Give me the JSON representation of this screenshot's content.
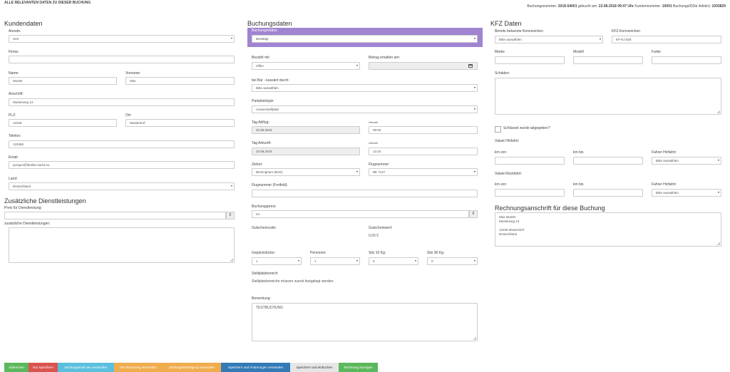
{
  "header": {
    "title": "ALLE RELEVANTEN DATEN ZU DIESER BUCHUNG",
    "info_prefix": "Buchungsnummer:",
    "booking_number": "2018-54001",
    "booked_prefix": "gebucht am:",
    "booked_at": "22.08.2018 09:47 Uhr",
    "customer_prefix": "Kundennummer:",
    "customer_number": "10001",
    "id_prefix": "BuchungsID(für Admin):",
    "booking_id": "1003829"
  },
  "kunden": {
    "title": "Kundendaten",
    "anrede_label": "Anrede:",
    "anrede": "Herr",
    "firma_label": "Firma:",
    "firma": "",
    "name_label": "Name:",
    "name": "Muster",
    "vorname_label": "Vorname:",
    "vorname": "Max",
    "anschrift_label": "Anschrift:",
    "anschrift": "Musterweg 13",
    "plz_label": "PLZ:",
    "plz": "12345",
    "ort_label": "Ort:",
    "ort": "Musterdorf",
    "telefon_label": "Telefon:",
    "telefon": "123456",
    "email_label": "Email:",
    "email": "juergen@familie-nacht.eu",
    "land_label": "Land:",
    "land": "Deutschland"
  },
  "zusatz": {
    "title": "Zusätzliche Dienstleistungen",
    "preis_label": "Preis für Dienstleistung:",
    "preis": "",
    "currency": "€",
    "dienst_label": "zusätzliche Dienstleistungen:",
    "dienst": ""
  },
  "buchung": {
    "title": "Buchungsdaten",
    "status_label": "Buchungsstatus",
    "status": "Bestätigt",
    "bezahlt_label": "Bezahlt mit",
    "bezahlt": "Offen",
    "betrag_label": "Betrag erhalten am:",
    "betrag": "",
    "bar_label": "bei Bar - kassiert durch:",
    "bar": "Bitte auswählen",
    "park_label": "Parkplatztype:",
    "park": "Aussenstellplatz",
    "abflug_label": "Tag Abflug:",
    "abflug": "22.08.2018",
    "uhr1_label": "Uhrzeit",
    "uhr1": "09:00",
    "ankunft_label": "Tag Ankunft:",
    "ankunft": "23.08.2018",
    "uhr2_label": "Uhrzeit",
    "uhr2": "13:15",
    "ziel_label": "Zielort:",
    "ziel": "Birmingham (BHX)",
    "flug_label": "Flugnummer:",
    "flug": "BE 7127",
    "flugfrei_label": "Flugnummer (Freifeld):",
    "flugfrei": "",
    "preis_label": "Buchungspreis:",
    "preis": "24",
    "currency": "€",
    "gutschein_label": "Gutscheincode:",
    "gutscheinwert_label": "Gutscheinwert:",
    "gutscheinwert": "0,00 €",
    "gepaeck_label": "Gepäckstücke:",
    "gepaeck": "1",
    "personen_label": "Personen:",
    "personen": "1",
    "sitz10_label": "Sitz 10 Kg:",
    "sitz10": "0",
    "sitz36_label": "Sitz 36 Kg:",
    "sitz36": "0",
    "stell_label": "Stellplatzbereich",
    "stell_text": "Stellplatzbereiche müssen zuerst festgelegt werden.",
    "bemerkung_label": "Bemerkung:",
    "bemerkung": "TESTBUCHUNG"
  },
  "kfz": {
    "title": "KFZ Daten",
    "bekannt_label": "Bereits bekannte Kennzeichen",
    "bekannt": "Bitte auswählen",
    "kennz_label": "KFZ-Kennzeichen",
    "kennz": "KF-NJ 528",
    "marke_label": "Marke",
    "modell_label": "Modell",
    "farbe_label": "Farbe",
    "schaeden_label": "Schäden:",
    "schluessel_label": "Schlüssel wurde abgegeben?",
    "hin_label": "Valuet Hinfahrt:",
    "km_von_label": "km von",
    "km_bis_label": "km bis",
    "fahrer_hin_label": "Fahrer Hinfahrt:",
    "fahrer_hin": "Bitte auswählen",
    "rueck_label": "Valuet Rückfahrt:",
    "km_von2_label": "km von",
    "km_bis2_label": "km bis",
    "fahrer_rueck_label": "Fahrer Hinfahrt:",
    "fahrer_rueck": "Bitte auswählen"
  },
  "rechnung": {
    "title": "Rechnungsanschrift für diese Buchung",
    "address": "Max Muster\nMusterweg 13\n\n12345 Musterdorf\nDeutschland"
  },
  "buttons": [
    {
      "label": "Abbrechen",
      "color": "#5cb85c"
    },
    {
      "label": "Nur Speichern",
      "color": "#d9534f"
    },
    {
      "label": "Buchungsmail neu versenden",
      "color": "#5bc0de"
    },
    {
      "label": "Nur Rechnung versenden",
      "color": "#f0ad4e"
    },
    {
      "label": "Zahlungsbestätigung versenden",
      "color": "#f0ad4e"
    },
    {
      "label": "Speichern und Änderungen versenden",
      "color": "#337ab7"
    },
    {
      "label": "Speichern und einbuchen",
      "color": "#e6e6e6"
    },
    {
      "label": "Rechnung anzeigen",
      "color": "#5cb85c"
    }
  ],
  "colors": {
    "status_bg": "#a084d1"
  }
}
